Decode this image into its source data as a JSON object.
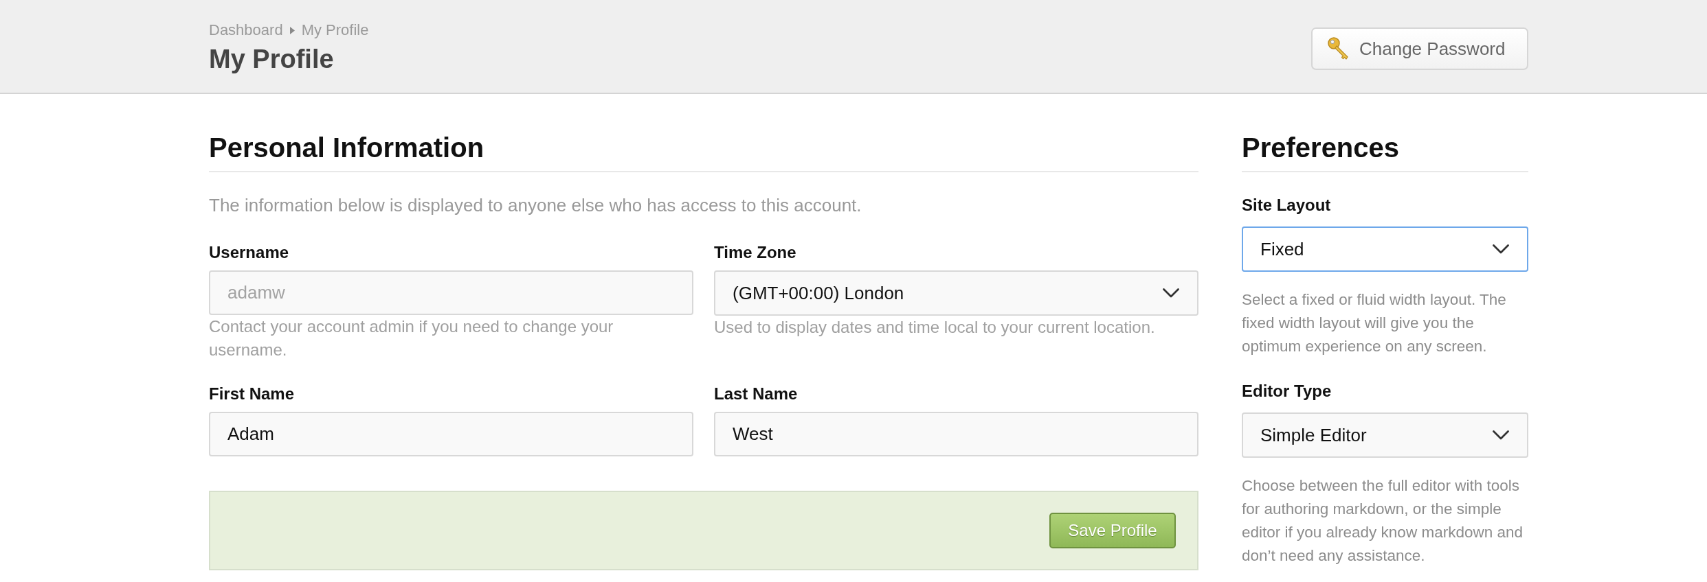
{
  "breadcrumb": [
    {
      "label": "Dashboard"
    },
    {
      "label": "My Profile"
    }
  ],
  "page_title": "My Profile",
  "header_button": {
    "label": "Change Password"
  },
  "personal_information": {
    "title": "Personal Information",
    "description": "The information below is displayed to anyone else who has access to this account.",
    "fields": [
      {
        "kind": "text",
        "label": "Username",
        "value": "adamw",
        "disabled": true,
        "help": "Contact your account admin if you need to change your username."
      },
      {
        "kind": "select",
        "label": "Time Zone",
        "value": "(GMT+00:00) London",
        "disabled": false,
        "help": "Used to display dates and time local to your current location."
      },
      {
        "kind": "text",
        "label": "First Name",
        "value": "Adam",
        "disabled": false
      },
      {
        "kind": "text",
        "label": "Last Name",
        "value": "West",
        "disabled": false
      }
    ],
    "save_button": {
      "label": "Save Profile"
    }
  },
  "preferences": {
    "title": "Preferences",
    "fields": [
      {
        "kind": "select",
        "label": "Site Layout",
        "value": "Fixed",
        "focused": true,
        "help": "Select a fixed or fluid width layout. The fixed width layout will give you the optimum experience on any screen."
      },
      {
        "kind": "select",
        "label": "Editor Type",
        "value": "Simple Editor",
        "focused": false,
        "help": "Choose between the full editor with tools for authoring markdown, or the simple editor if you already know markdown and don’t need any assistance."
      }
    ]
  }
}
